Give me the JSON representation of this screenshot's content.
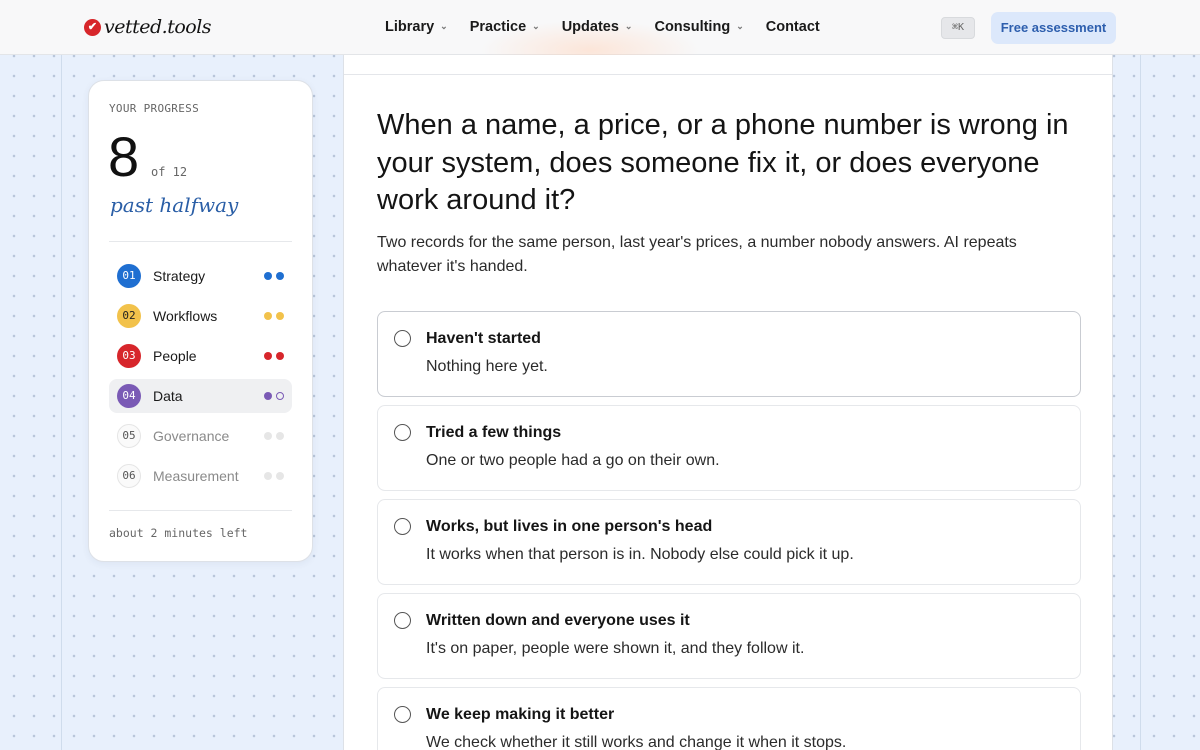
{
  "header": {
    "logo_text": "vetted.tools",
    "logo_icon": "check-badge-icon",
    "nav": [
      {
        "label": "Library",
        "has_menu": true
      },
      {
        "label": "Practice",
        "has_menu": true
      },
      {
        "label": "Updates",
        "has_menu": true
      },
      {
        "label": "Consulting",
        "has_menu": true
      },
      {
        "label": "Contact",
        "has_menu": false
      }
    ],
    "shortcut": "⌘K",
    "cta_label": "Free assessment"
  },
  "progress": {
    "label": "YOUR PROGRESS",
    "current": "8",
    "total_text": "of 12",
    "status": "past halfway",
    "time_left": "about 2 minutes left",
    "sections": [
      {
        "num": "01",
        "name": "Strategy",
        "color": "#1f6fd1",
        "dots": [
          "filled",
          "filled"
        ],
        "state": "done"
      },
      {
        "num": "02",
        "name": "Workflows",
        "color": "#f2c24b",
        "dots": [
          "filled",
          "filled"
        ],
        "state": "done"
      },
      {
        "num": "03",
        "name": "People",
        "color": "#d7262b",
        "dots": [
          "filled",
          "filled"
        ],
        "state": "done"
      },
      {
        "num": "04",
        "name": "Data",
        "color": "#7a5ab5",
        "dots": [
          "filled",
          "empty"
        ],
        "state": "active"
      },
      {
        "num": "05",
        "name": "Governance",
        "color": "#e4e4e4",
        "dots": [
          "empty",
          "empty"
        ],
        "state": "todo"
      },
      {
        "num": "06",
        "name": "Measurement",
        "color": "#e4e4e4",
        "dots": [
          "empty",
          "empty"
        ],
        "state": "todo"
      }
    ]
  },
  "question": {
    "title": "When a name, a price, or a phone number is wrong in your system, does someone fix it, or does everyone work around it?",
    "subtitle": "Two records for the same person, last year's prices, a number nobody answers. AI repeats whatever it's handed.",
    "options": [
      {
        "title": "Haven't started",
        "desc": "Nothing here yet."
      },
      {
        "title": "Tried a few things",
        "desc": "One or two people had a go on their own."
      },
      {
        "title": "Works, but lives in one person's head",
        "desc": "It works when that person is in. Nobody else could pick it up."
      },
      {
        "title": "Written down and everyone uses it",
        "desc": "It's on paper, people were shown it, and they follow it."
      },
      {
        "title": "We keep making it better",
        "desc": "We check whether it still works and change it when it stops."
      }
    ]
  }
}
